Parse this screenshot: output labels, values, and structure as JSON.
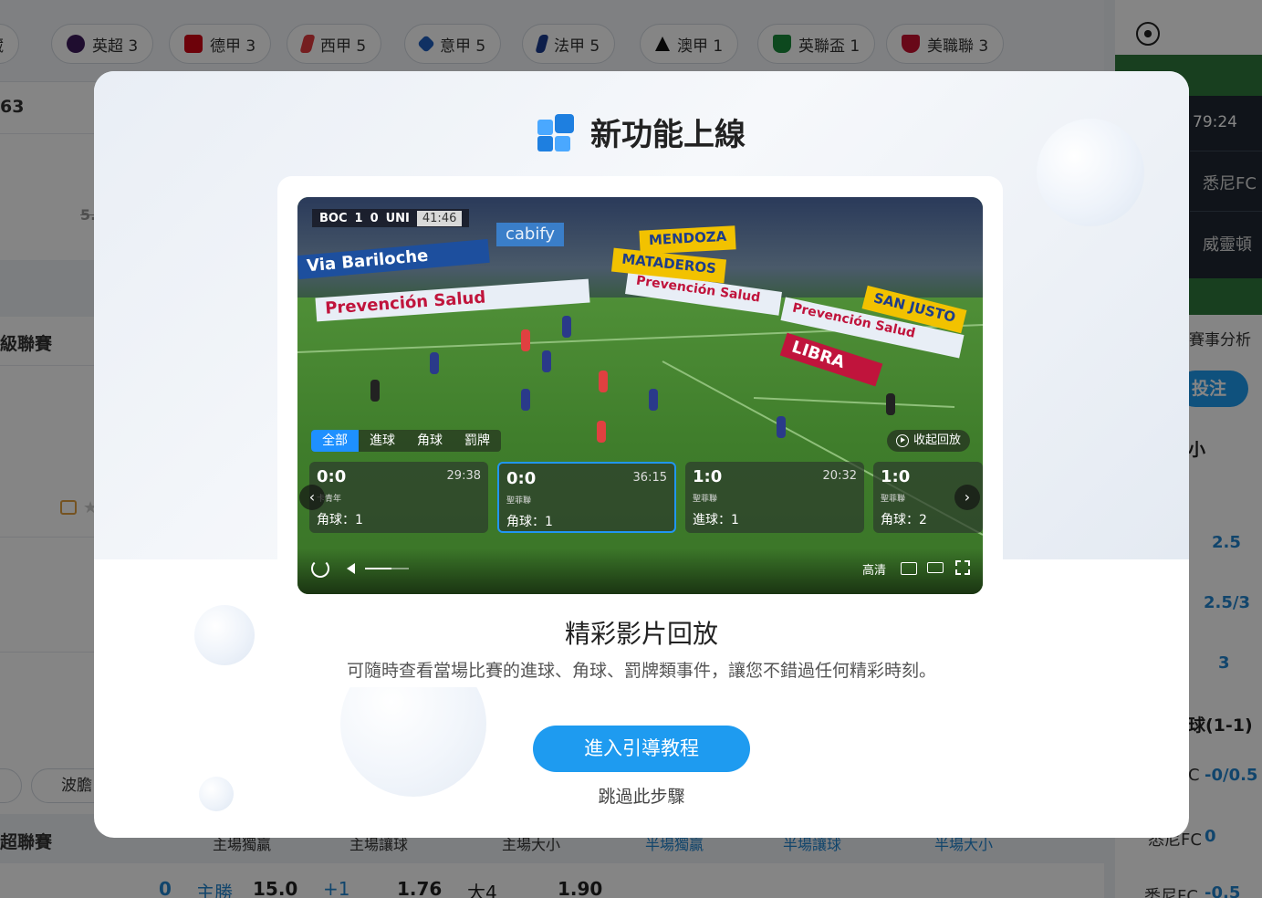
{
  "leagues": [
    {
      "label": "藏",
      "icon": "star-icon",
      "color": "#888888"
    },
    {
      "label": "英超 3",
      "icon": "premier-league-icon",
      "color": "#3d195b"
    },
    {
      "label": "德甲 3",
      "icon": "bundesliga-icon",
      "color": "#d20515"
    },
    {
      "label": "西甲 5",
      "icon": "laliga-icon",
      "color": "#e03a3e"
    },
    {
      "label": "意甲 5",
      "icon": "serie-a-icon",
      "color": "#1f5fbf"
    },
    {
      "label": "法甲 5",
      "icon": "ligue1-icon",
      "color": "#1a3a8f"
    },
    {
      "label": "澳甲 1",
      "icon": "a-league-icon",
      "color": "#111111"
    },
    {
      "label": "英聯盃 1",
      "icon": "carabao-cup-icon",
      "color": "#1a8a3a"
    },
    {
      "label": "美職聯 3",
      "icon": "mls-icon",
      "color": "#c8102e"
    }
  ],
  "background": {
    "row_value": "63",
    "odds_strike": "5.",
    "section1": "級聯賽",
    "section2": "超聯賽",
    "wave_tab": "波膽",
    "col_headers": [
      "主場獨贏",
      "主場讓球",
      "主場大小",
      "半場獨贏",
      "半場讓球",
      "半場大小"
    ],
    "bottom_row": [
      "0",
      "主勝",
      "15.0",
      "+1",
      "1.76",
      "大4",
      "1.90"
    ]
  },
  "right_panel": {
    "match_time": "79:24",
    "team1": "悉尼FC",
    "team2": "威靈頓",
    "analysis": "賽事分析",
    "bet_button": "投注",
    "size_label": "小",
    "odds": [
      "2.5",
      "2.5/3",
      "3"
    ],
    "half_label": "球(1-1)",
    "handicap1": "-0/0.5",
    "handicap1_team": "C",
    "handicap2_team": "悉尼FC",
    "handicap2": "0",
    "handicap3_team": "悉尼FC",
    "handicap3": "-0.5"
  },
  "modal": {
    "title": "新功能上線",
    "feature_title": "精彩影片回放",
    "feature_desc": "可隨時查看當場比賽的進球、角球、罰牌類事件，讓您不錯過任何精彩時刻。",
    "cta_label": "進入引導教程",
    "skip_label": "跳過此步驟"
  },
  "video": {
    "home": "BOC",
    "home_score": "1",
    "away_score": "0",
    "away": "UNI",
    "clock": "41:46",
    "banners": [
      "Via Bariloche",
      "Prevención Salud",
      "cabify",
      "Prevención Salud",
      "Prevención Salud",
      "LIBRA",
      "MATADEROS",
      "MENDOZA",
      "SAN JUSTO"
    ],
    "filter_tabs": [
      "全部",
      "進球",
      "角球",
      "罰牌"
    ],
    "active_tab": 0,
    "collapse_label": "收起回放",
    "events": [
      {
        "score": "0:0",
        "time": "29:38",
        "team": "卡青年",
        "type": "角球：1"
      },
      {
        "score": "0:0",
        "time": "36:15",
        "team": "聖菲聯",
        "type": "角球：1"
      },
      {
        "score": "1:0",
        "time": "20:32",
        "team": "聖菲聯",
        "type": "進球：1"
      },
      {
        "score": "1:0",
        "time": "",
        "team": "聖菲聯",
        "type": "角球：2"
      }
    ],
    "selected_event": 1,
    "quality_label": "高清",
    "volume_level": 0.6
  }
}
